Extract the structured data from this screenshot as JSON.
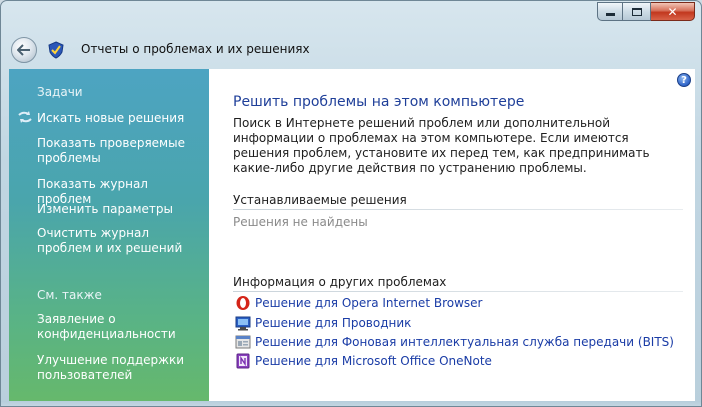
{
  "window": {
    "title": "Отчеты о проблемах и их решениях",
    "controls": {
      "minimize": "minimize-icon",
      "maximize": "maximize-icon",
      "close": "✕"
    }
  },
  "sidebar": {
    "tasks_heading": "Задачи",
    "tasks": [
      {
        "label": "Искать новые решения",
        "icon": "arrows-icon"
      },
      {
        "label": "Показать проверяемые проблемы"
      },
      {
        "label": "Показать журнал проблем"
      },
      {
        "label": "Изменить параметры"
      },
      {
        "label": "Очистить журнал проблем и их решений"
      }
    ],
    "see_also_heading": "См. также",
    "see_also": [
      {
        "label": "Заявление о конфиденциальности"
      },
      {
        "label": "Улучшение поддержки пользователей"
      }
    ]
  },
  "main": {
    "help": "?",
    "title": "Решить проблемы на этом компьютере",
    "intro": "Поиск в Интернете решений проблем или дополнительной информации о проблемах на этом компьютере. Если имеются решения проблем, установите их перед тем, как предпринимать какие-либо другие действия по устранению проблемы.",
    "installable_heading": "Устанавливаемые решения",
    "installable_empty": "Решения не найдены",
    "other_heading": "Информация о других проблемах",
    "other_links": [
      {
        "label": "Решение для Opera Internet Browser",
        "icon": "opera-icon"
      },
      {
        "label": "Решение для Проводник",
        "icon": "explorer-icon"
      },
      {
        "label": "Решение для Фоновая интеллектуальная служба передачи (BITS)",
        "icon": "bits-service-icon"
      },
      {
        "label": "Решение для Microsoft Office OneNote",
        "icon": "onenote-icon"
      }
    ]
  },
  "colors": {
    "link": "#1a3ca6",
    "title": "#1f3f99",
    "sidebar_top": "#4da4c2",
    "sidebar_bottom": "#66b86c"
  }
}
